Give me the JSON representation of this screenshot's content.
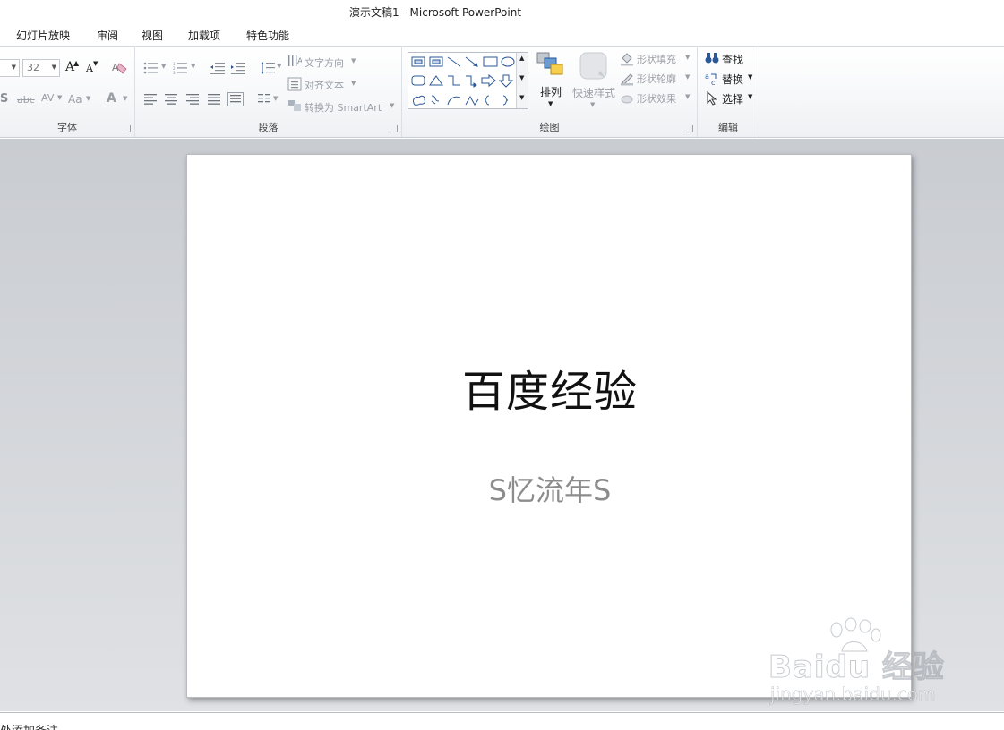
{
  "window": {
    "title": "演示文稿1  -  Microsoft PowerPoint"
  },
  "menu": {
    "tabs": [
      "幻灯片放映",
      "审阅",
      "视图",
      "加载项",
      "特色功能"
    ]
  },
  "ribbon": {
    "font_group": {
      "label": "字体",
      "font_size": "32",
      "grow_font": "A",
      "shrink_font": "A",
      "shadow": "S",
      "strikethrough": "abc",
      "spacing": "AV",
      "change_case": "Aa",
      "font_color": "A"
    },
    "paragraph_group": {
      "label": "段落",
      "text_direction": "文字方向",
      "align_text": "对齐文本",
      "convert_smartart": "转换为 SmartArt"
    },
    "drawing_group": {
      "label": "绘图",
      "arrange": "排列",
      "quick_styles": "快速样式",
      "shape_fill": "形状填充",
      "shape_outline": "形状轮廓",
      "shape_effects": "形状效果"
    },
    "editing_group": {
      "label": "编辑",
      "find": "查找",
      "replace": "替换",
      "select": "选择"
    }
  },
  "slide": {
    "title": "百度经验",
    "subtitle": "S忆流年S"
  },
  "notes": {
    "placeholder": "处添加备注"
  },
  "watermark": {
    "logo": "Baidu 经验",
    "url": "jingyan.baidu.com"
  },
  "colors": {
    "accent_blue": "#2b5797",
    "workspace": "#c9ccd1"
  }
}
